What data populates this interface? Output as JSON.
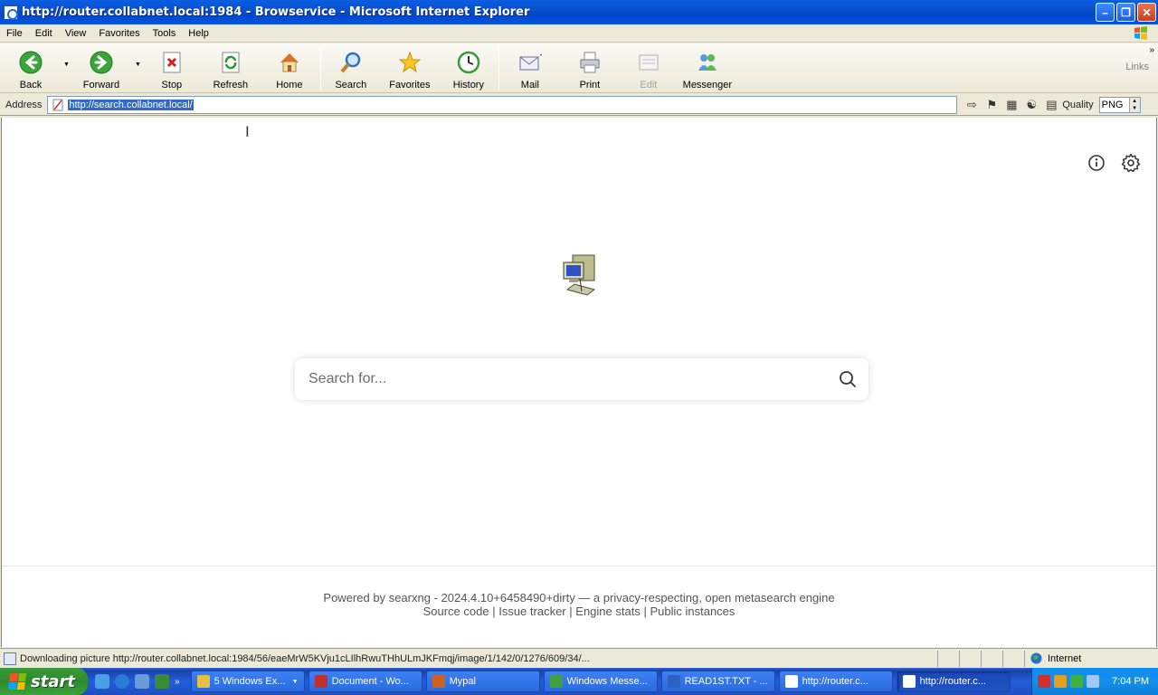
{
  "window": {
    "title": "http://router.collabnet.local:1984 - Browservice - Microsoft Internet Explorer",
    "controls": [
      "minimize",
      "maximize",
      "close"
    ]
  },
  "menu": [
    "File",
    "Edit",
    "View",
    "Favorites",
    "Tools",
    "Help"
  ],
  "toolbar": {
    "back": "Back",
    "forward": "Forward",
    "stop": "Stop",
    "refresh": "Refresh",
    "home": "Home",
    "search": "Search",
    "favorites": "Favorites",
    "history": "History",
    "mail": "Mail",
    "print": "Print",
    "edit": "Edit",
    "messenger": "Messenger",
    "links": "Links"
  },
  "address": {
    "label": "Address",
    "url": "http://search.collabnet.local/",
    "quality_label": "Quality",
    "quality_value": "PNG"
  },
  "page": {
    "search_placeholder": "Search for...",
    "footer": {
      "powered_by": "Powered by",
      "engine_name": "searxng",
      "version_text": "- 2024.4.10+6458490+dirty — a privacy-respecting, open metasearch engine",
      "links": [
        "Source code",
        "Issue tracker",
        "Engine stats",
        "Public instances"
      ],
      "separator": "|"
    }
  },
  "status": {
    "text": "Downloading picture http://router.collabnet.local:1984/56/eaeMrW5KVju1cLIlhRwuTHhULmJKFmqj/image/1/142/0/1276/609/34/...",
    "zone": "Internet"
  },
  "taskbar": {
    "start": "start",
    "tasks": [
      {
        "label": "5 Windows Ex...",
        "icon_color": "#e8c040",
        "active": false,
        "group": true
      },
      {
        "label": "Document - Wo...",
        "icon_color": "#c03030",
        "active": false
      },
      {
        "label": "Mypal",
        "icon_color": "#d06020",
        "active": false
      },
      {
        "label": "Windows Messe...",
        "icon_color": "#40a040",
        "active": false
      },
      {
        "label": "READ1ST.TXT - ...",
        "icon_color": "#3060c0",
        "active": false
      },
      {
        "label": "http://router.c...",
        "icon_color": "#ffffff",
        "active": false
      },
      {
        "label": "http://router.c...",
        "icon_color": "#ffffff",
        "active": true
      }
    ],
    "clock": "7:04 PM"
  }
}
